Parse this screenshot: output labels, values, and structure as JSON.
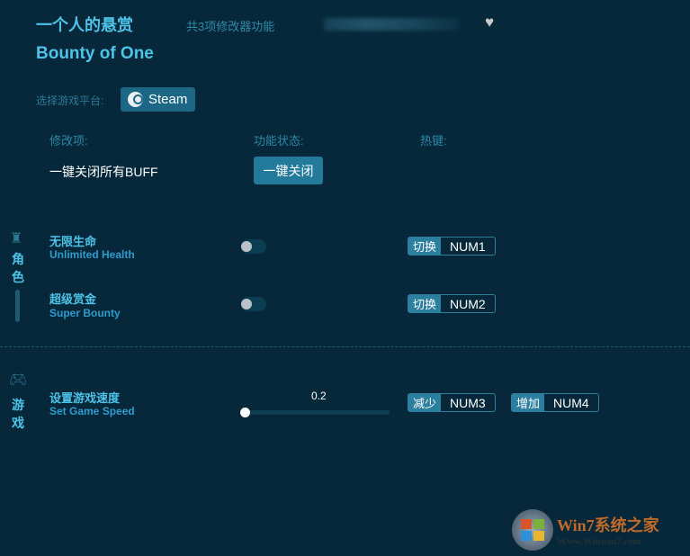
{
  "header": {
    "title_cn": "一个人的悬赏",
    "feature_count": "共3项修改器功能",
    "title_en": "Bounty of One",
    "favorite_icon": "heart-icon"
  },
  "platform": {
    "label": "选择游戏平台:",
    "selected": "Steam"
  },
  "columns": {
    "item": "修改项:",
    "status": "功能状态:",
    "hotkey": "热键:"
  },
  "buff": {
    "label": "一键关闭所有BUFF",
    "button": "一键关闭"
  },
  "sections": [
    {
      "name": "角色",
      "chars": [
        "角",
        "色"
      ],
      "items": [
        {
          "cn": "无限生命",
          "en": "Unlimited Health",
          "enabled": false,
          "hotkey_action": "切换",
          "hotkey": "NUM1"
        },
        {
          "cn": "超级赏金",
          "en": "Super Bounty",
          "enabled": false,
          "hotkey_action": "切换",
          "hotkey": "NUM2"
        }
      ]
    },
    {
      "name": "游戏",
      "chars": [
        "游",
        "戏"
      ],
      "items": [
        {
          "cn": "设置游戏速度",
          "en": "Set Game Speed",
          "value": "0.2",
          "slider_fraction": 0.0,
          "dec_action": "减少",
          "dec_key": "NUM3",
          "inc_action": "增加",
          "inc_key": "NUM4"
        }
      ]
    }
  ],
  "watermark": {
    "brand": "Win7系统之家",
    "url": "Www.Winwin7.com"
  },
  "colors": {
    "background": "#06283a",
    "accent": "#4ec3e8",
    "button": "#237a9a"
  }
}
